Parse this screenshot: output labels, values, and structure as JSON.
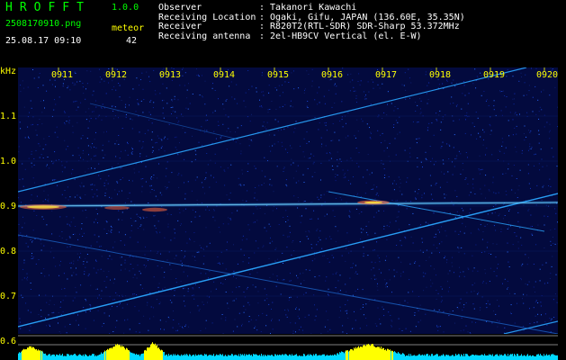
{
  "header": {
    "app_title": "HROFFT",
    "version": "1.0.0",
    "file_name": "2508170910.png",
    "date_time": "25.08.17 09:10",
    "mode": "meteor",
    "count": "42"
  },
  "info": [
    {
      "key": "Observer",
      "sep": ":",
      "value": "Takanori Kawachi"
    },
    {
      "key": "Receiving Location",
      "sep": ":",
      "value": "Ogaki, Gifu, JAPAN (136.60E, 35.35N)"
    },
    {
      "key": "Receiver",
      "sep": ":",
      "value": "R820T2(RTL-SDR) SDR-Sharp 53.372MHz"
    },
    {
      "key": "Receiving antenna",
      "sep": ":",
      "value": "2el-HB9CV Vertical (el. E-W)"
    }
  ],
  "axis": {
    "unit": "kHz",
    "y_labels": [
      "1.1",
      "1.0",
      "0.9",
      "0.8",
      "0.7",
      "0.6"
    ],
    "x_labels": [
      "0911",
      "0912",
      "0913",
      "0914",
      "0915",
      "0916",
      "0917",
      "0918",
      "0919",
      "0920"
    ]
  },
  "colors": {
    "background": "#000000",
    "plot_background": "#030a3e",
    "title": "#00ff00",
    "axis_text": "#ffff00",
    "trace": "#2aa6ff",
    "meteor": "#ff6a3a",
    "signal_yellow": "#ffff00",
    "signal_cyan": "#00d8ff"
  }
}
